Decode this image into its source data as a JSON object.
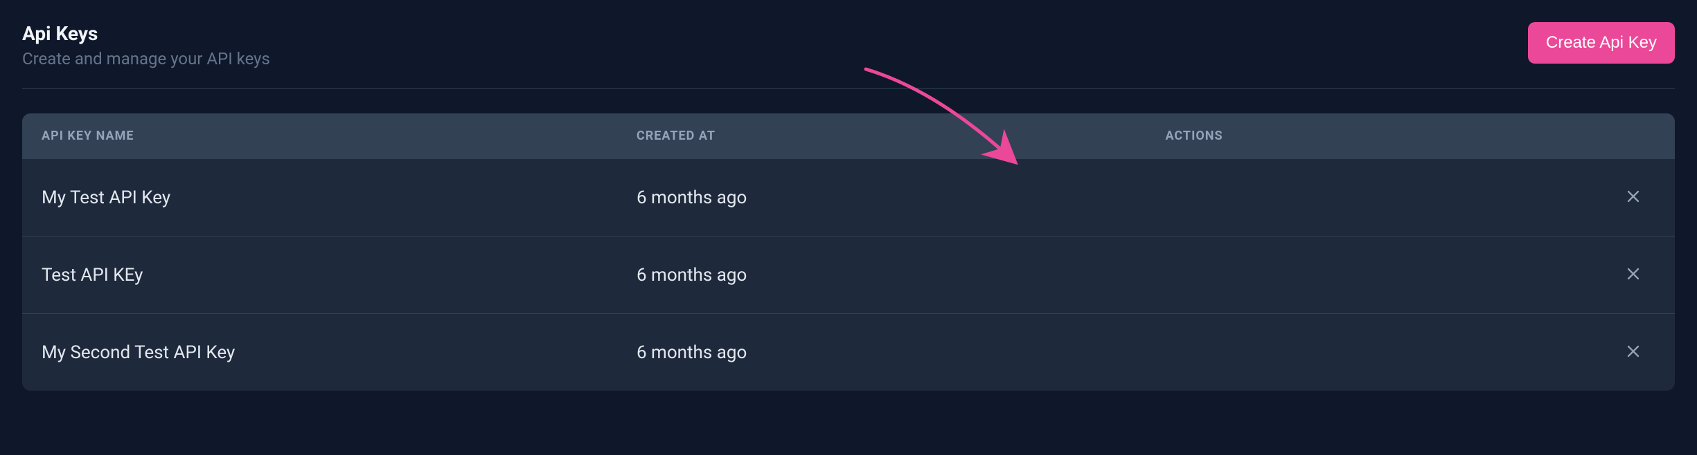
{
  "header": {
    "title": "Api Keys",
    "subtitle": "Create and manage your API keys",
    "create_button_label": "Create Api Key"
  },
  "table": {
    "columns": {
      "name": "API KEY NAME",
      "created": "CREATED AT",
      "actions": "ACTIONS"
    },
    "rows": [
      {
        "name": "My Test API Key",
        "created_at": "6 months ago"
      },
      {
        "name": "Test API KEy",
        "created_at": "6 months ago"
      },
      {
        "name": "My Second Test API Key",
        "created_at": "6 months ago"
      }
    ]
  },
  "colors": {
    "accent": "#ec4899",
    "background": "#0f172a",
    "panel": "#1e293b",
    "panel_header": "#334155"
  }
}
